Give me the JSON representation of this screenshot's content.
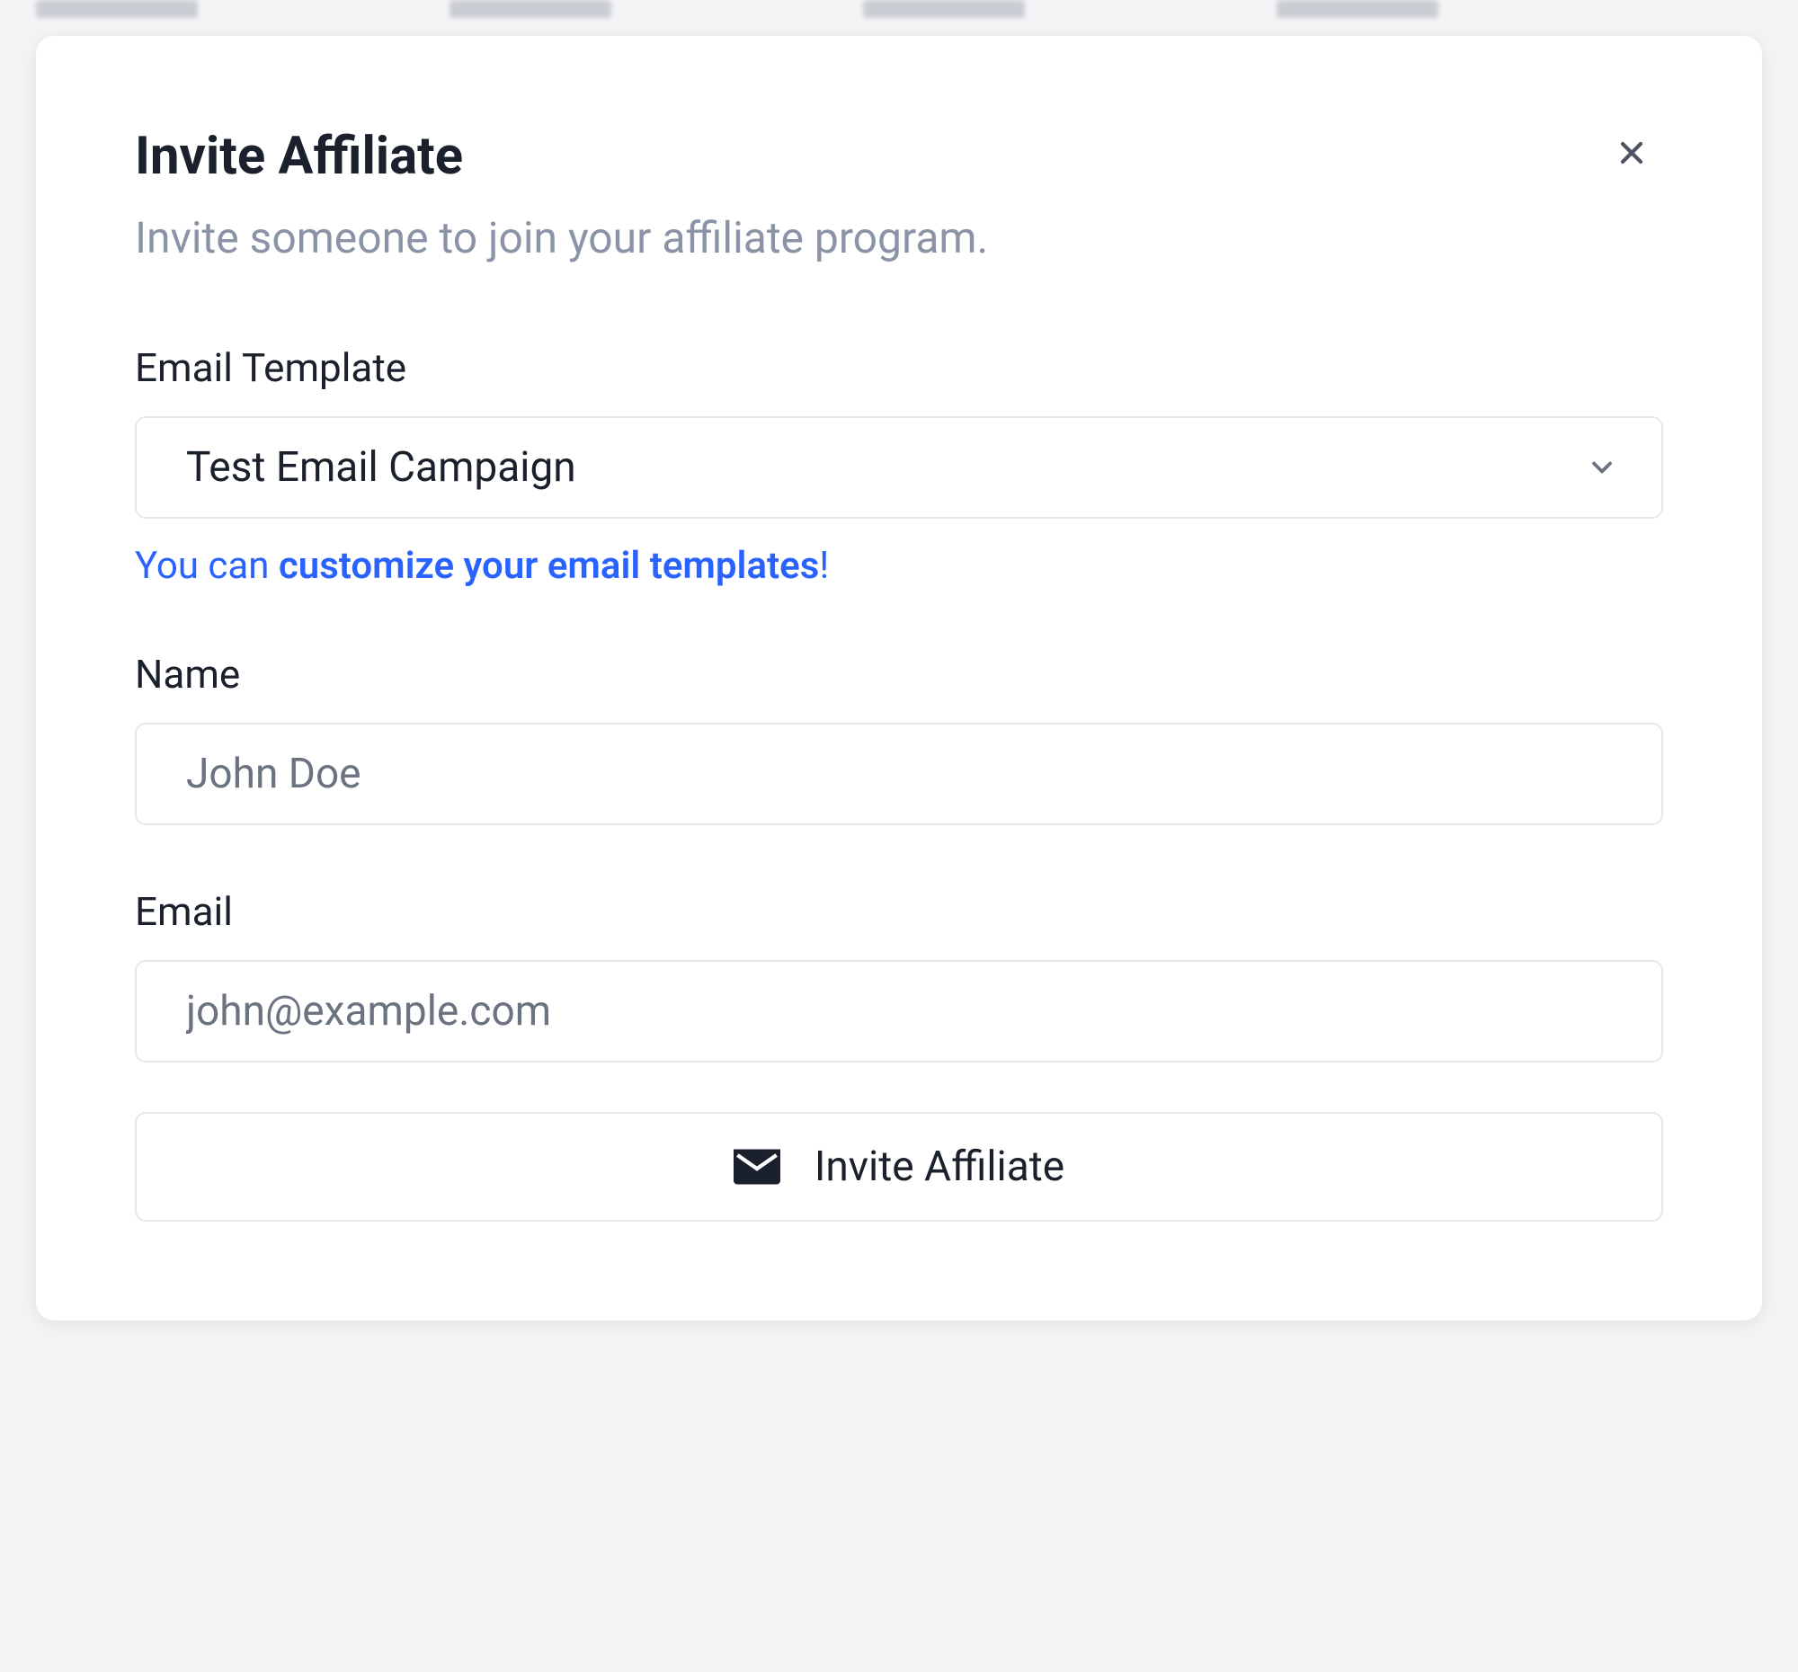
{
  "modal": {
    "title": "Invite Affiliate",
    "subtitle": "Invite someone to join your affiliate program.",
    "close_label": "Close"
  },
  "form": {
    "email_template": {
      "label": "Email Template",
      "value": "Test Email Campaign"
    },
    "hint": {
      "prefix": "You can ",
      "link_text": "customize your email templates",
      "suffix": "!"
    },
    "name": {
      "label": "Name",
      "placeholder": "John Doe",
      "value": ""
    },
    "email": {
      "label": "Email",
      "placeholder": "john@example.com",
      "value": ""
    },
    "submit_label": "Invite Affiliate"
  }
}
